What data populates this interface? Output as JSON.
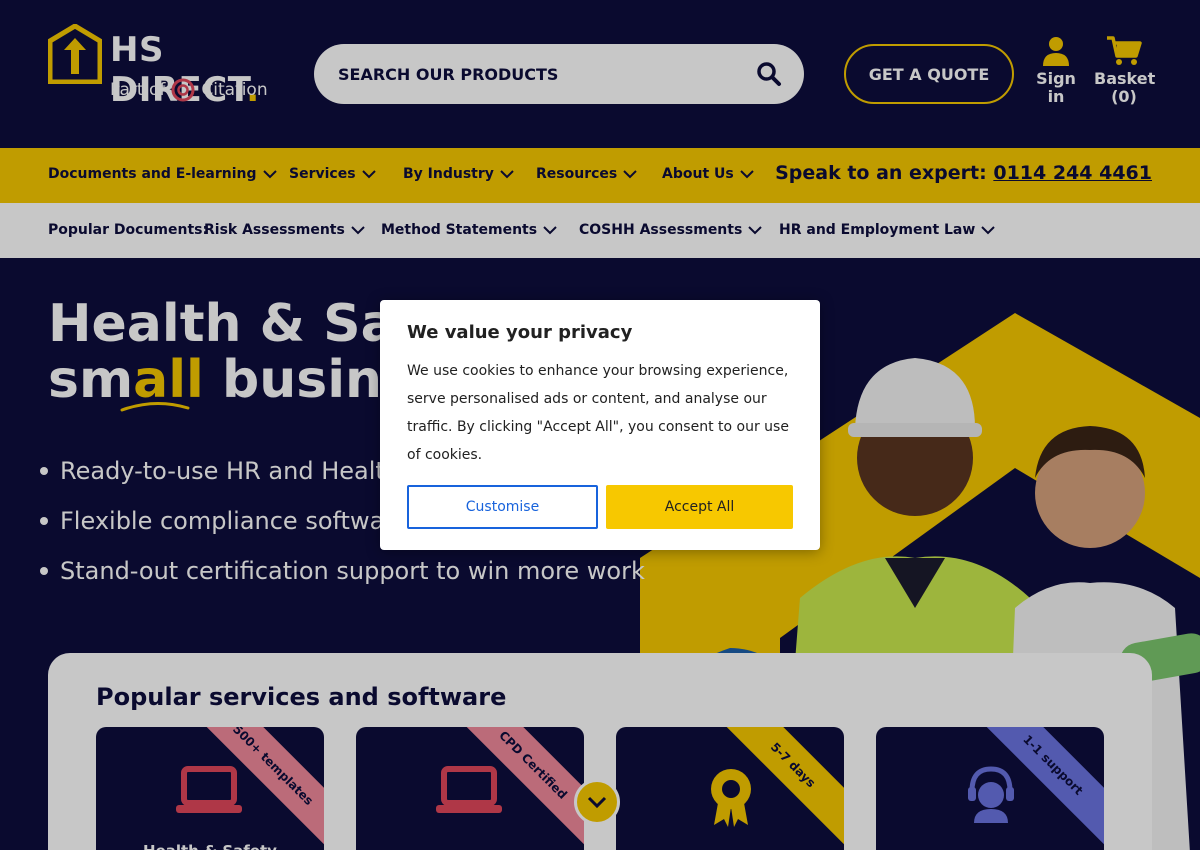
{
  "colors": {
    "navy": "#0e0e3d",
    "yellow": "#f7c800",
    "white": "#ffffff",
    "cta_blue": "#1863dc",
    "pink": "#e0475b"
  },
  "header": {
    "brand": "HS DIRECT",
    "brand_dot": ".",
    "sub_prefix": "Part of",
    "sub_brand": "Citation",
    "search_placeholder": "SEARCH OUR PRODUCTS",
    "quote_label": "GET A QUOTE",
    "signin_label": "Sign in",
    "basket_label": "Basket",
    "basket_count": "(0)"
  },
  "nav": {
    "items": [
      {
        "label": "Documents and E-learning"
      },
      {
        "label": "Services"
      },
      {
        "label": "By Industry"
      },
      {
        "label": "Resources"
      },
      {
        "label": "About Us"
      }
    ],
    "expert_label": "Speak to an expert:",
    "expert_phone": "0114 244 4461"
  },
  "popular": {
    "label": "Popular Documents:",
    "items": [
      {
        "label": "Risk Assessments"
      },
      {
        "label": "Method Statements"
      },
      {
        "label": "COSHH Assessments"
      },
      {
        "label": "HR and Employment Law"
      }
    ]
  },
  "hero": {
    "title_line1": "Health & Safe",
    "title_line2_a": "sm",
    "title_line2_hl": "all",
    "title_line2_b": " busines",
    "bullets": [
      "Ready-to-use HR and Health",
      "Flexible compliance software",
      "Stand-out certification support to win more work"
    ]
  },
  "services": {
    "title": "Popular services and software",
    "cards": [
      {
        "ribbon": "500+ templates",
        "ribbon_color": "#f08a9b",
        "icon": "laptop-icon",
        "title": "Health & Safety"
      },
      {
        "ribbon": "CPD Certified",
        "ribbon_color": "#f08a9b",
        "icon": "laptop-icon",
        "title": ""
      },
      {
        "ribbon": "5-7 days",
        "ribbon_color": "#f7c800",
        "icon": "award-icon",
        "title": ""
      },
      {
        "ribbon": "1-1 support",
        "ribbon_color": "#6b74e0",
        "icon": "support-agent-icon",
        "title": ""
      }
    ]
  },
  "cookie": {
    "title": "We value your privacy",
    "body": "We use cookies to enhance your browsing experience, serve personalised ads or content, and analyse our traffic. By clicking \"Accept All\", you consent to our use of cookies.",
    "customise_label": "Customise",
    "accept_label": "Accept All"
  }
}
